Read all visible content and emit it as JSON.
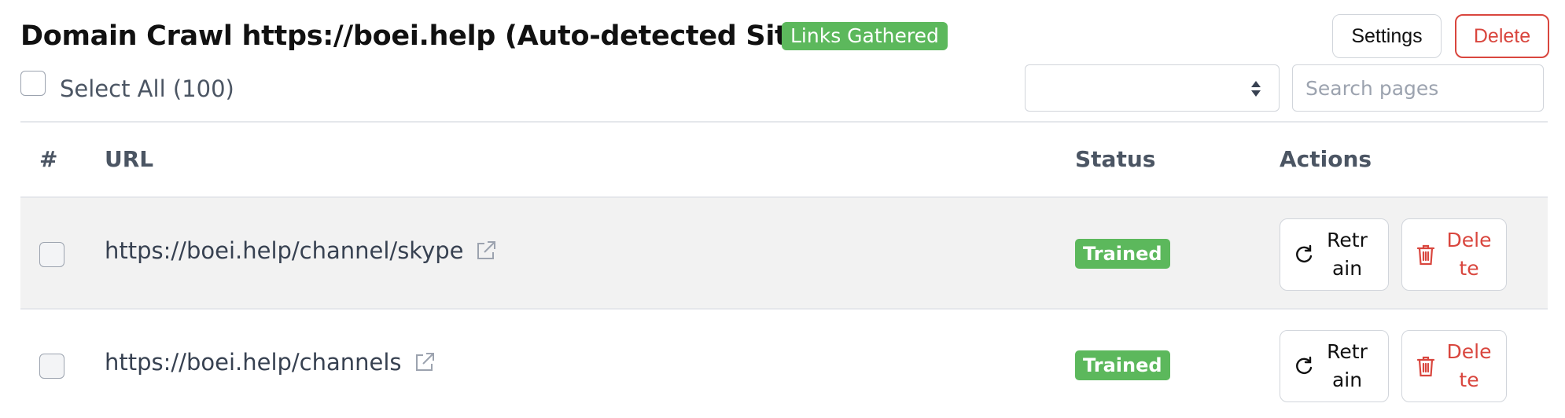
{
  "header": {
    "title": "Domain Crawl https://boei.help (Auto-detected Sitemap)",
    "badge": "Links Gathered",
    "settings_label": "Settings",
    "delete_label": "Delete"
  },
  "toolbar": {
    "select_all_label": "Select All (100)",
    "dropdown_value": "",
    "search_placeholder": "Search pages",
    "search_value": ""
  },
  "table": {
    "columns": [
      "#",
      "URL",
      "Status",
      "Actions"
    ],
    "rows": [
      {
        "url": "https://boei.help/channel/skype",
        "status": "Trained",
        "retrain_label": "Retrain",
        "delete_label": "Delete"
      },
      {
        "url": "https://boei.help/channels",
        "status": "Trained",
        "retrain_label": "Retrain",
        "delete_label": "Delete"
      }
    ]
  },
  "icons": {
    "external_link": "external-link-icon",
    "retrain": "refresh-icon",
    "delete": "trash-icon",
    "select_arrows": "sort-arrows-icon"
  },
  "colors": {
    "success": "#5cb85c",
    "danger": "#d9463e",
    "row_shade": "#f2f2f2",
    "border": "#d1d5db"
  }
}
